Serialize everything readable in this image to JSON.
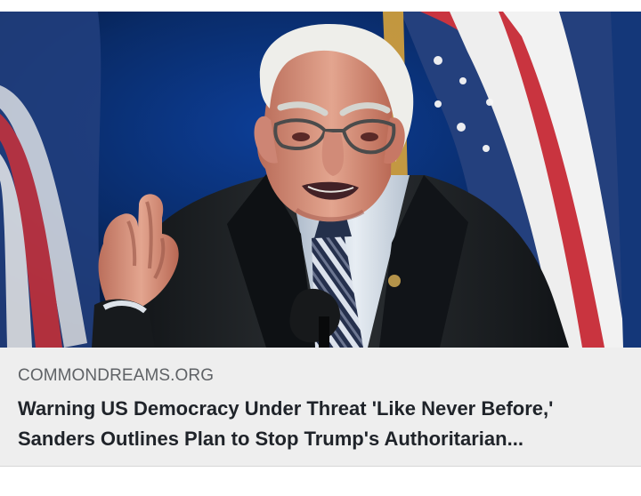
{
  "link_preview": {
    "source": "COMMONDREAMS.ORG",
    "headline_lines": [
      "Warning US Democracy Under Threat 'Like Never Before,'",
      "Sanders Outlines Plan to Stop Trump's Authoritarian..."
    ]
  },
  "image": {
    "subject": "portrait-photo",
    "icon": "speaker-photo"
  },
  "colors": {
    "card_background": "#eeeeee",
    "headline_text": "#1f2329",
    "source_text": "#5f6266",
    "flag_red": "#c9343f",
    "flag_blue": "#243e7b"
  }
}
